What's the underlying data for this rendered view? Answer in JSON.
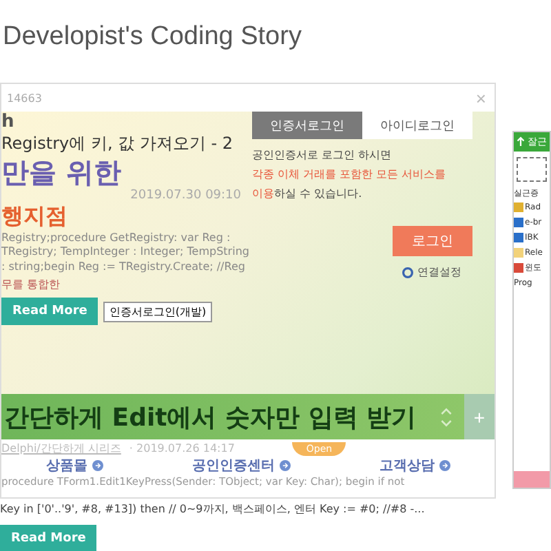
{
  "blog_title": "Developist's Coding Story",
  "window": {
    "title": "14663",
    "close": "×"
  },
  "post": {
    "banner_letter": "h",
    "title": "Registry에 키, 값 가져오기 - 2",
    "slogan": "만을 위한",
    "date": "2019.07.30 09:10",
    "branch": "행지점",
    "excerpt": "Registry;procedure GetRegistry: var Reg : TRegistry; TempInteger : Integer; TempString : string;begin Reg := TRegistry.Create; //Reg",
    "note": "무를 통합한",
    "read_more": "Read More",
    "tooltip": "인증서로그인(개발)"
  },
  "login": {
    "tabs": [
      {
        "label": "인증서로그인",
        "selected": true
      },
      {
        "label": "아이디로그인",
        "selected": false
      }
    ],
    "line1": "공인인증서로 로그인 하시면",
    "line2": "각종 이체 거래를 포함한 모든 서비스를",
    "line3": "**이용**하실 수 있습니다.",
    "button": "로그인",
    "settings": "연결설정"
  },
  "banner": {
    "title": "간단하게 Edit에서 숫자만 입력 받기",
    "plus": "+"
  },
  "post2": {
    "category": "Delphi/간단하게 시리즈",
    "date": "· 2019.07.26 14:17",
    "open_tab": "Open",
    "menu": [
      "상품몰",
      "공인인증센터",
      "고객상담"
    ],
    "line1": "procedure TForm1.Edit1KeyPress(Sender: TObject; var Key: Char); begin if not",
    "line2": "Key in ['0'..'9', #8, #13]) then // 0~9까지, 백스페이스, 엔터 Key := #0; //#8 -...",
    "read_more": "Read More"
  },
  "side_panel": {
    "header": "잘근",
    "label": "실근증",
    "items": [
      {
        "label": "Rad",
        "kind": "letter"
      },
      {
        "label": "e-br",
        "kind": "browser"
      },
      {
        "label": "IBK",
        "kind": "browser"
      },
      {
        "label": "Rele",
        "kind": "folder"
      },
      {
        "label": "윈도",
        "kind": "chrome"
      },
      {
        "label": "Prog",
        "kind": "blank"
      }
    ]
  }
}
